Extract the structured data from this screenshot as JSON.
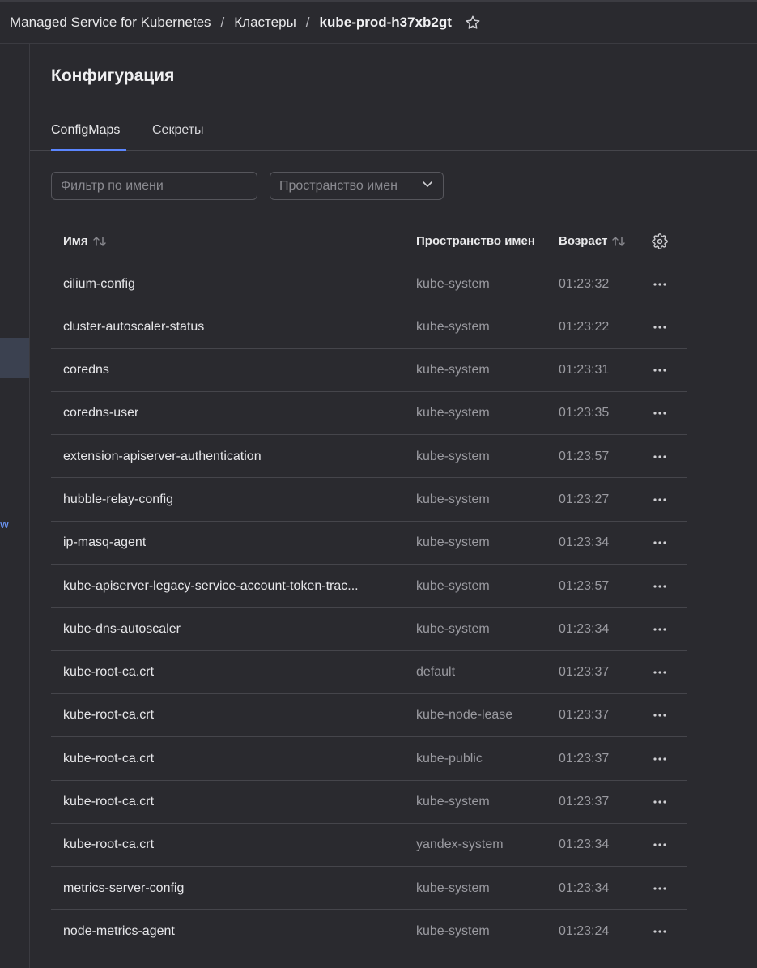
{
  "breadcrumbs": {
    "service": "Managed Service for Kubernetes",
    "clusters": "Кластеры",
    "cluster": "kube-prod-h37xb2gt",
    "separator": "/"
  },
  "sidebar": {
    "link_fragment": "w"
  },
  "page": {
    "title": "Конфигурация"
  },
  "tabs": [
    {
      "label": "ConfigMaps",
      "active": true
    },
    {
      "label": "Секреты",
      "active": false
    }
  ],
  "filters": {
    "name_placeholder": "Фильтр по имени",
    "name_value": "",
    "namespace_placeholder": "Пространство имен"
  },
  "table": {
    "columns": {
      "name": "Имя",
      "namespace": "Пространство имен",
      "age": "Возраст"
    },
    "rows": [
      {
        "name": "cilium-config",
        "namespace": "kube-system",
        "age": "01:23:32"
      },
      {
        "name": "cluster-autoscaler-status",
        "namespace": "kube-system",
        "age": "01:23:22"
      },
      {
        "name": "coredns",
        "namespace": "kube-system",
        "age": "01:23:31"
      },
      {
        "name": "coredns-user",
        "namespace": "kube-system",
        "age": "01:23:35"
      },
      {
        "name": "extension-apiserver-authentication",
        "namespace": "kube-system",
        "age": "01:23:57"
      },
      {
        "name": "hubble-relay-config",
        "namespace": "kube-system",
        "age": "01:23:27"
      },
      {
        "name": "ip-masq-agent",
        "namespace": "kube-system",
        "age": "01:23:34"
      },
      {
        "name": "kube-apiserver-legacy-service-account-token-trac...",
        "namespace": "kube-system",
        "age": "01:23:57"
      },
      {
        "name": "kube-dns-autoscaler",
        "namespace": "kube-system",
        "age": "01:23:34"
      },
      {
        "name": "kube-root-ca.crt",
        "namespace": "default",
        "age": "01:23:37"
      },
      {
        "name": "kube-root-ca.crt",
        "namespace": "kube-node-lease",
        "age": "01:23:37"
      },
      {
        "name": "kube-root-ca.crt",
        "namespace": "kube-public",
        "age": "01:23:37"
      },
      {
        "name": "kube-root-ca.crt",
        "namespace": "kube-system",
        "age": "01:23:37"
      },
      {
        "name": "kube-root-ca.crt",
        "namespace": "yandex-system",
        "age": "01:23:34"
      },
      {
        "name": "metrics-server-config",
        "namespace": "kube-system",
        "age": "01:23:34"
      },
      {
        "name": "node-metrics-agent",
        "namespace": "kube-system",
        "age": "01:23:24"
      }
    ]
  },
  "colors": {
    "background": "#2a2a2f",
    "accent": "#5b86ff",
    "border": "#45454b",
    "muted_text": "#9a9aa0"
  },
  "icons": {
    "favorite": "star-icon",
    "sort": "sort-arrows-icon",
    "settings": "gear-icon",
    "row_menu": "ellipsis-icon",
    "dropdown": "chevron-down-icon"
  }
}
